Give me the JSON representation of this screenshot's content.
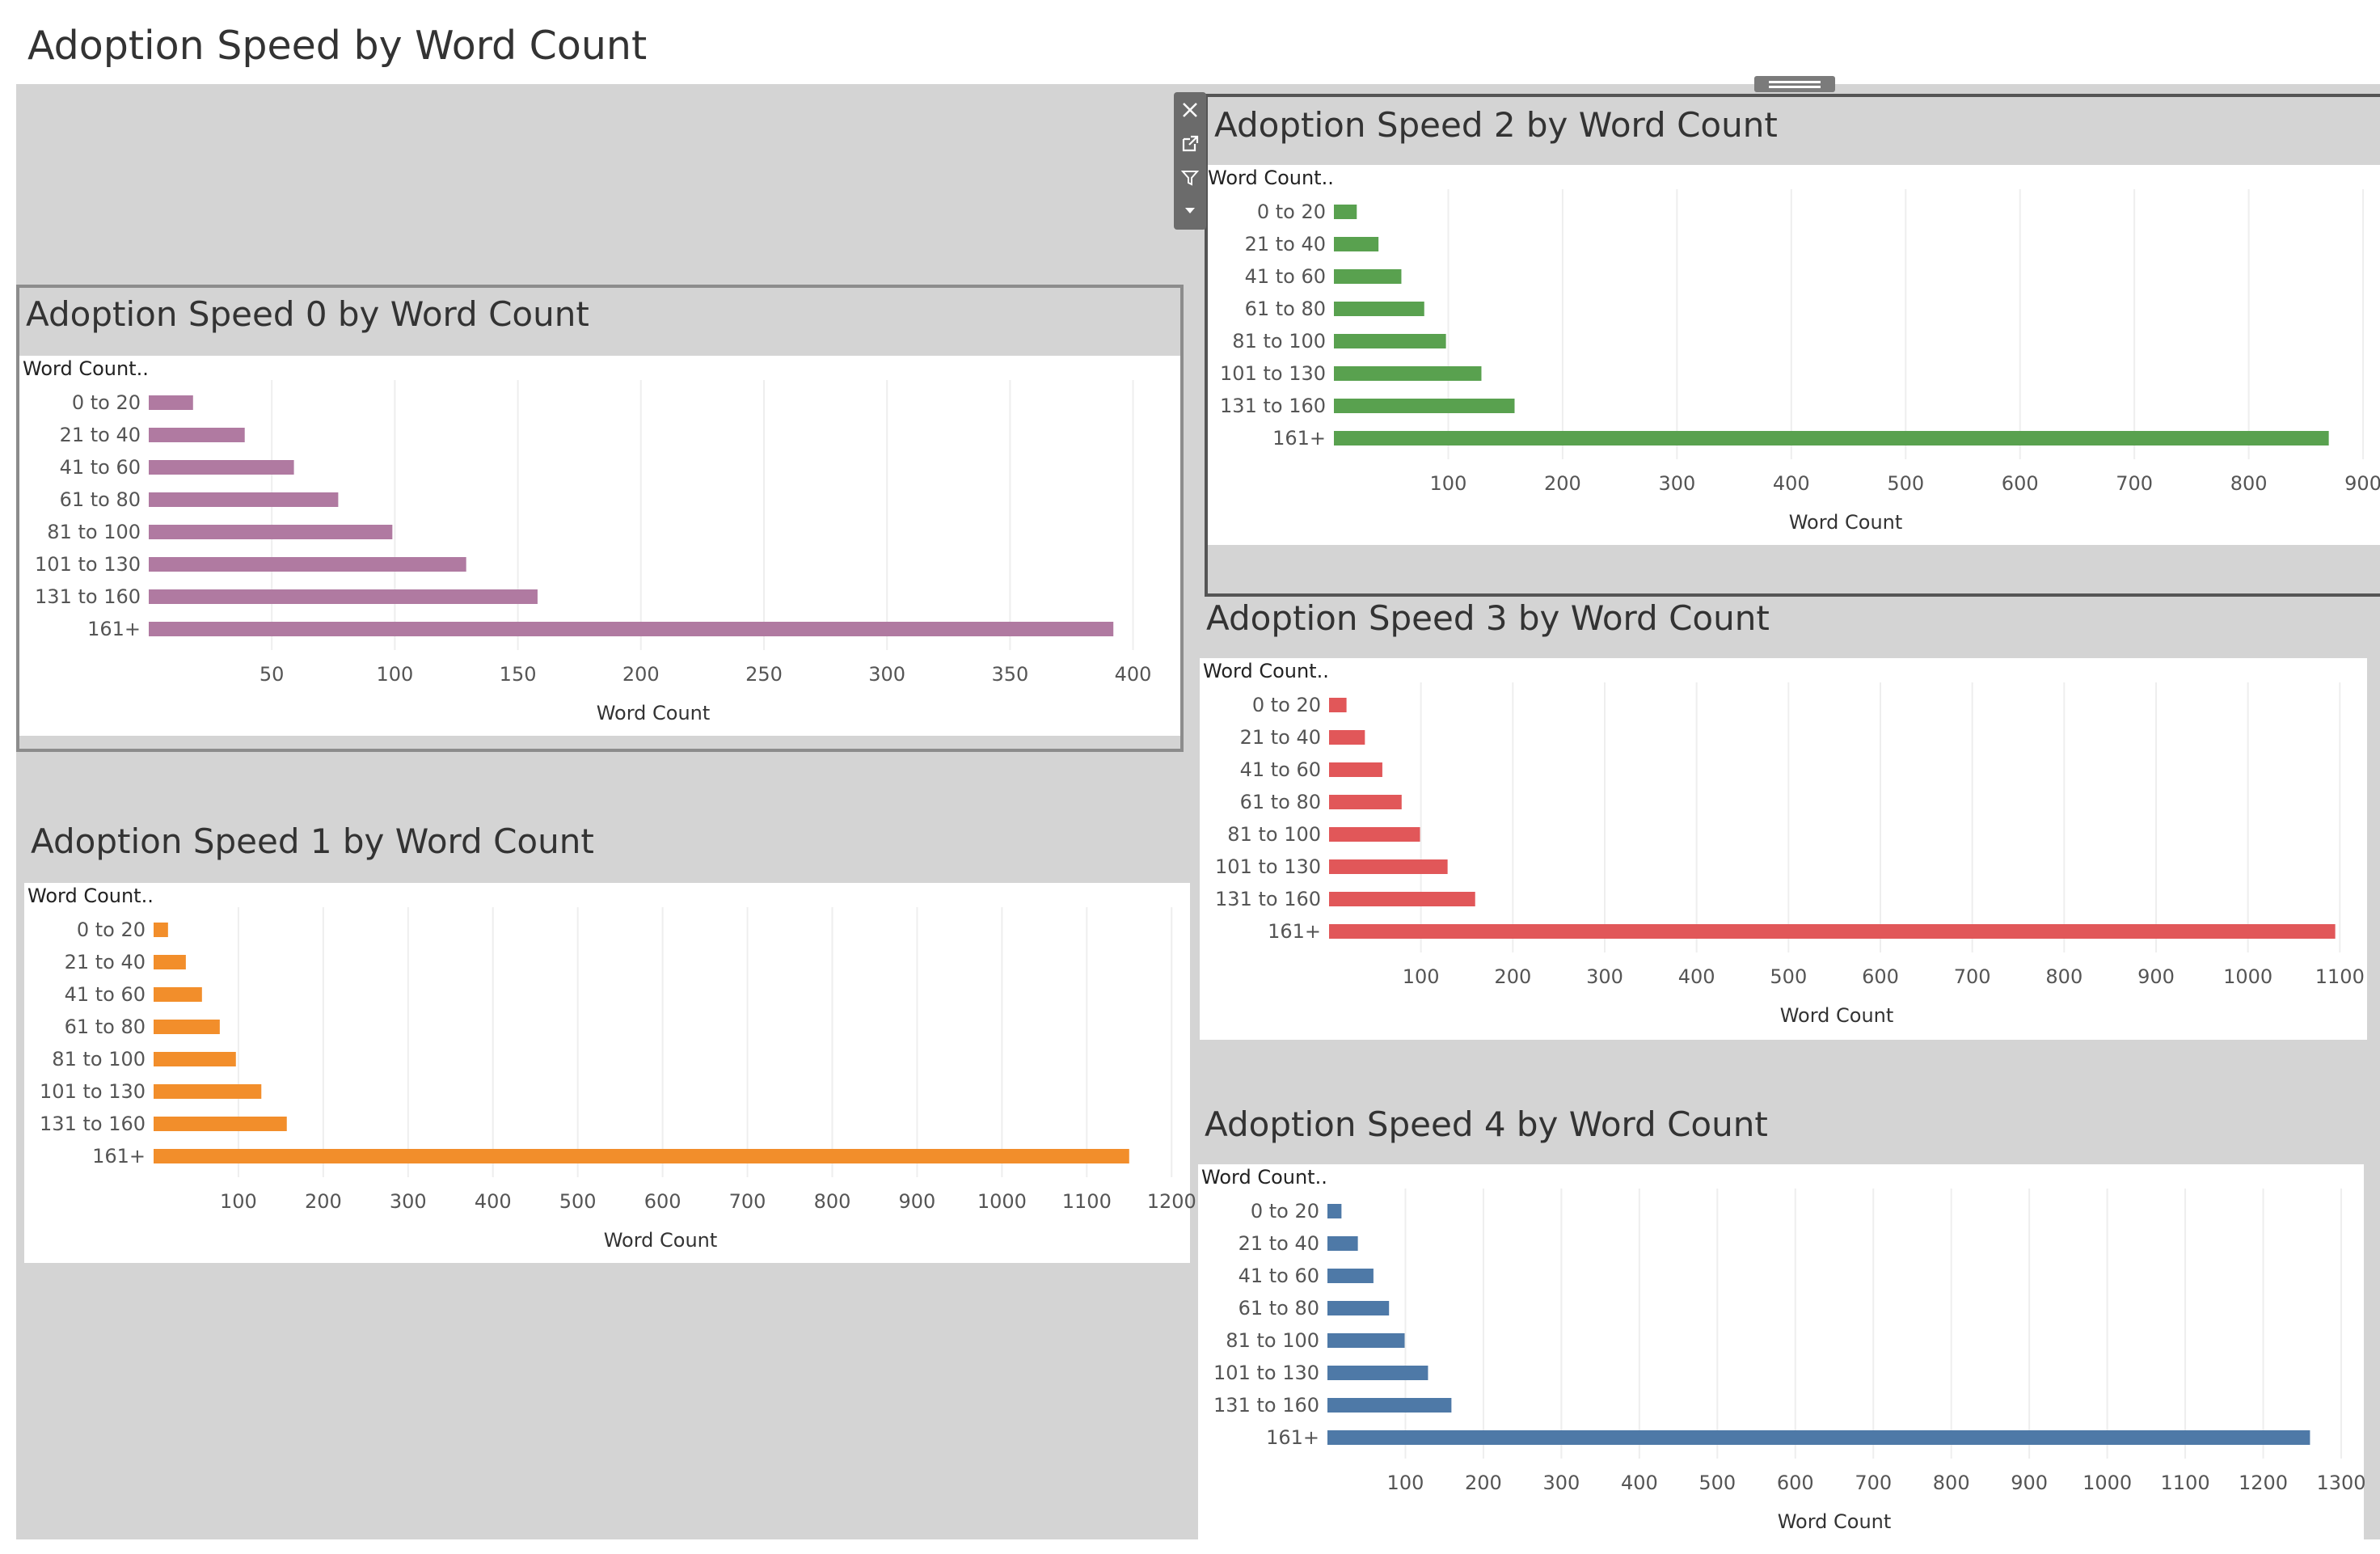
{
  "dashboard": {
    "title": "Adoption Speed by Word Count"
  },
  "colors": {
    "speed0": "#b07aa1",
    "speed1": "#f28e2b",
    "speed2": "#59a14f",
    "speed3": "#e15759",
    "speed4": "#4e79a7",
    "canvas": "#d4d4d4",
    "grid": "#eeeeee"
  },
  "toolbar": {
    "icons": [
      "close-icon",
      "open-external-icon",
      "filter-icon",
      "dropdown-arrow-icon"
    ]
  },
  "chart_data": [
    {
      "type": "bar",
      "title": "Adoption Speed 0 by Word Count",
      "row_header": "Word Count..",
      "xlabel": "Word Count",
      "categories": [
        "0 to 20",
        "21 to 40",
        "41 to 60",
        "61 to 80",
        "81 to 100",
        "101 to 130",
        "131 to 160",
        "161+"
      ],
      "values": [
        18,
        39,
        59,
        77,
        99,
        129,
        158,
        392
      ],
      "xlim": [
        0,
        410
      ],
      "ticks": [
        50,
        100,
        150,
        200,
        250,
        300,
        350,
        400
      ],
      "orientation": "horizontal",
      "color": "#b07aa1"
    },
    {
      "type": "bar",
      "title": "Adoption Speed 1 by Word Count",
      "row_header": "Word Count..",
      "xlabel": "Word Count",
      "categories": [
        "0 to 20",
        "21 to 40",
        "41 to 60",
        "61 to 80",
        "81 to 100",
        "101 to 130",
        "131 to 160",
        "161+"
      ],
      "values": [
        17,
        38,
        57,
        78,
        97,
        127,
        157,
        1150
      ],
      "xlim": [
        0,
        1195
      ],
      "ticks": [
        100,
        200,
        300,
        400,
        500,
        600,
        700,
        800,
        900,
        1000,
        1100,
        1200
      ],
      "orientation": "horizontal",
      "color": "#f28e2b"
    },
    {
      "type": "bar",
      "title": "Adoption Speed 2 by Word Count",
      "row_header": "Word Count..",
      "xlabel": "Word Count",
      "categories": [
        "0 to 20",
        "21 to 40",
        "41 to 60",
        "61 to 80",
        "81 to 100",
        "101 to 130",
        "131 to 160",
        "161+"
      ],
      "values": [
        20,
        39,
        59,
        79,
        98,
        129,
        158,
        870
      ],
      "xlim": [
        0,
        895
      ],
      "ticks": [
        100,
        200,
        300,
        400,
        500,
        600,
        700,
        800,
        900
      ],
      "orientation": "horizontal",
      "color": "#59a14f"
    },
    {
      "type": "bar",
      "title": "Adoption Speed 3 by Word Count",
      "row_header": "Word Count..",
      "xlabel": "Word Count",
      "categories": [
        "0 to 20",
        "21 to 40",
        "41 to 60",
        "61 to 80",
        "81 to 100",
        "101 to 130",
        "131 to 160",
        "161+"
      ],
      "values": [
        19,
        39,
        58,
        79,
        99,
        129,
        159,
        1095
      ],
      "xlim": [
        0,
        1105
      ],
      "ticks": [
        100,
        200,
        300,
        400,
        500,
        600,
        700,
        800,
        900,
        1000,
        1100
      ],
      "orientation": "horizontal",
      "color": "#e15759"
    },
    {
      "type": "bar",
      "title": "Adoption Speed 4 by Word Count",
      "row_header": "Word Count..",
      "xlabel": "Word Count",
      "categories": [
        "0 to 20",
        "21 to 40",
        "41 to 60",
        "61 to 80",
        "81 to 100",
        "101 to 130",
        "131 to 160",
        "161+"
      ],
      "values": [
        18,
        39,
        59,
        79,
        99,
        129,
        159,
        1260
      ],
      "xlim": [
        0,
        1300
      ],
      "ticks": [
        100,
        200,
        300,
        400,
        500,
        600,
        700,
        800,
        900,
        1000,
        1100,
        1200,
        1300
      ],
      "orientation": "horizontal",
      "color": "#4e79a7"
    }
  ]
}
